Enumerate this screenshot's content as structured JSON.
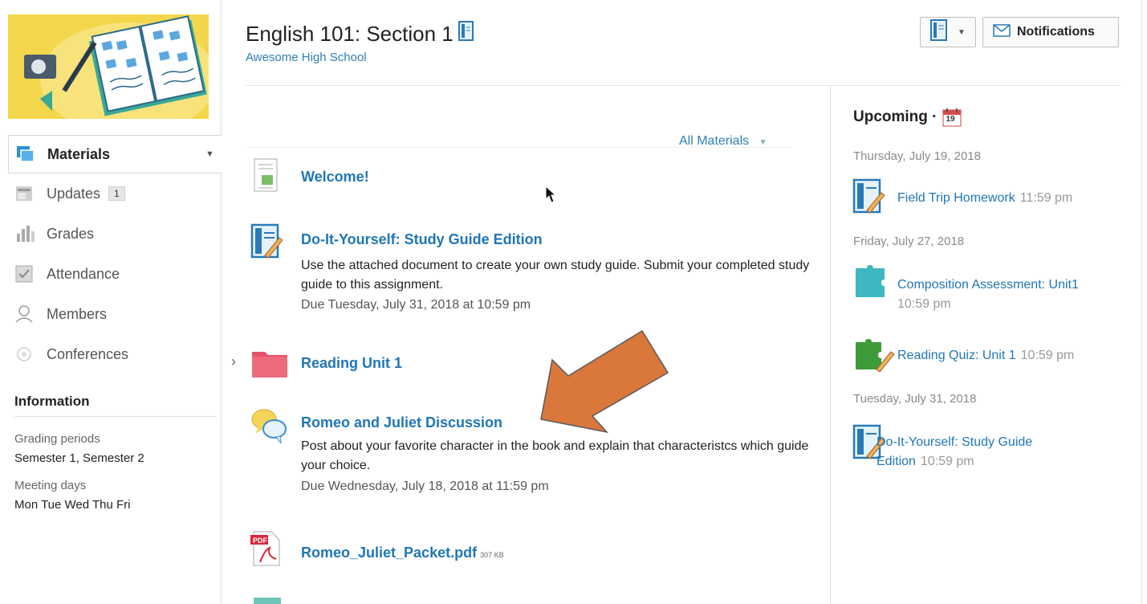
{
  "course": {
    "title": "English 101: Section 1",
    "school": "Awesome High School"
  },
  "header": {
    "notifications_label": "Notifications"
  },
  "sidebar": {
    "items": [
      {
        "label": "Materials",
        "icon": "materials-icon"
      },
      {
        "label": "Updates",
        "badge": "1",
        "icon": "updates-icon"
      },
      {
        "label": "Grades",
        "icon": "grades-icon"
      },
      {
        "label": "Attendance",
        "icon": "attendance-icon"
      },
      {
        "label": "Members",
        "icon": "members-icon"
      },
      {
        "label": "Conferences",
        "icon": "conferences-icon"
      }
    ],
    "information": {
      "title": "Information",
      "grading_label": "Grading periods",
      "grading_value": "Semester 1, Semester 2",
      "meeting_label": "Meeting days",
      "meeting_value": "Mon Tue Wed Thu Fri"
    }
  },
  "materials": {
    "filter_label": "All Materials",
    "items": [
      {
        "title": "Welcome!",
        "icon": "page-icon"
      },
      {
        "title": "Do-It-Yourself: Study Guide Edition",
        "icon": "assignment-icon",
        "description": "Use the attached document to create your own study guide. Submit your completed study guide to this assignment.",
        "due": "Due Tuesday, July 31, 2018 at 10:59 pm"
      },
      {
        "title": "Reading Unit 1",
        "icon": "folder-icon"
      },
      {
        "title": "Romeo and Juliet Discussion",
        "icon": "discussion-icon",
        "description": "Post about your favorite character in the book and explain that characteristcs which guide your choice.",
        "due": "Due Wednesday, July 18, 2018 at 11:59 pm"
      },
      {
        "title": "Romeo_Juliet_Packet.pdf",
        "size": "307 KB",
        "icon": "pdf-icon"
      }
    ]
  },
  "upcoming": {
    "title": "Upcoming ·",
    "calendar_day": "19",
    "dates": [
      "Thursday, July 19, 2018",
      "Friday, July 27, 2018",
      "Tuesday, July 31, 2018"
    ],
    "items": [
      {
        "name": "Field Trip Homework",
        "time": "11:59 pm",
        "icon": "assignment-icon"
      },
      {
        "name": "Composition Assessment: Unit1",
        "time": "10:59 pm",
        "icon": "assessment-puzzle-icon"
      },
      {
        "name": "Reading Quiz: Unit 1",
        "time": "10:59 pm",
        "icon": "quiz-puzzle-icon"
      },
      {
        "name_line1": "Do-It-Yourself: Study Guide",
        "name_line2": "Edition",
        "time": "10:59 pm",
        "icon": "assignment-icon"
      }
    ]
  },
  "colors": {
    "link": "#1f76b6",
    "banner": "#f3d64b",
    "arrow": "#d9783a",
    "folder": "#e2546a"
  }
}
